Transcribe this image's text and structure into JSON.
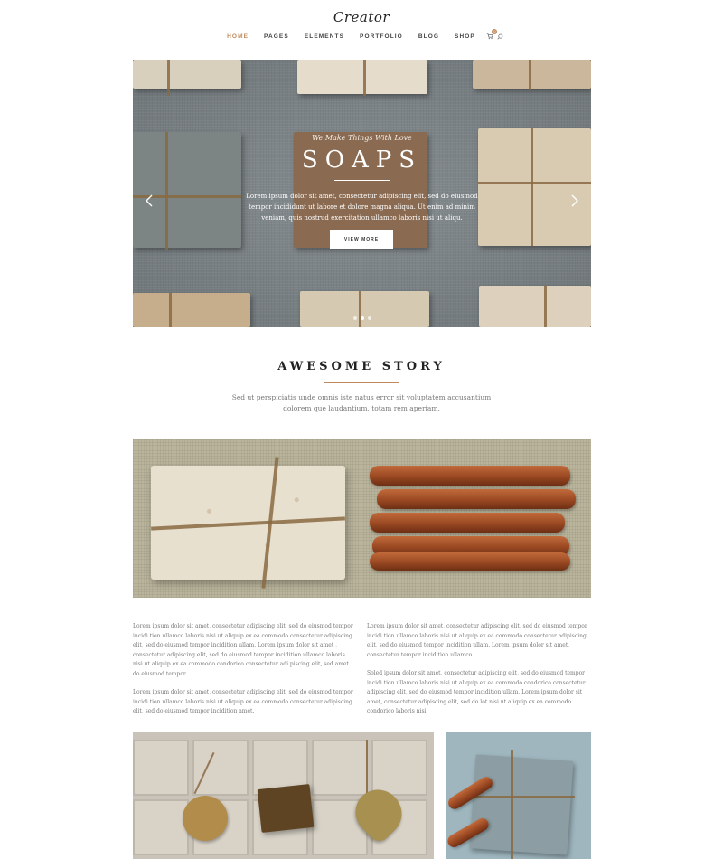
{
  "logo": "Creator",
  "nav": {
    "items": [
      "HOME",
      "PAGES",
      "ELEMENTS",
      "PORTFOLIO",
      "BLOG",
      "SHOP"
    ],
    "active": "HOME",
    "cart_count": "0",
    "icons": [
      "cart-icon",
      "search-icon"
    ]
  },
  "hero": {
    "tagline": "We Make Things With Love",
    "title": "SOAPS",
    "description": "Lorem ipsum dolor sit amet, consectetur adipiscing elit, sed do eiusmod tempor incididunt ut labore et dolore magna aliqua. Ut enim ad minim veniam, quis nostrud exercitation ullamco laboris nisi ut aliqu.",
    "button": "VIEW MORE",
    "slide_count": 3,
    "active_slide": 2
  },
  "story": {
    "title": "AWESOME STORY",
    "text": "Sed ut perspiciatis unde omnis iste natus error sit voluptatem accusantium dolorem que laudantium, totam rem aperiam."
  },
  "columns": {
    "left": [
      "Lorem ipsum dolor sit amet, consectetur adipiscing elit, sed do eiusmod tempor incidi tion ullamco laboris nisi ut aliquip ex ea commodo consectetur adipiscing elit, sed do eiusmod tempor incidition ullam. Lorem ipsum dolor sit amet , consectetur adipiscing elit, sed do eiusmod tempor incidition ullamco laboris nisi ut aliquip ex ea commodo condorico consectetur adi piscing elit, sed amet do eiusmod tempor.",
      "Lorem ipsum dolor sit amet, consectetur adipiscing elit, sed do eiusmod tempor incidi tion ullamco laboris nisi ut aliquip ex ea commodo consectetur adipiscing elit, sed do eiusmod tempor incidition amet."
    ],
    "right": [
      "Lorem ipsum dolor sit amet, consectetur adipiscing elit, sed do eiusmod tempor incidi tion ullamco laboris nisi ut aliquip ex ea commodo consectetur adipiscing elit, sed do eiusmod tempor incidition ullam. Lorem ipsum dolor sit amet, consectetur tempor incidition ullamco.",
      "Soled ipsum dolor sit amet, consectetur adipiscing elit, sed do eiusmod tempor incidi tion ullamco laboris nisi ut aliquip ex ea commodo condorico consectetur adipiscing elit, sed do eiusmod tempor incidition ullam. Lorem ipsum dolor sit amet, consectetur adipiscing elit, sed do lot nisi ut aliquip ex ea commodo condorico laboris nisi."
    ]
  },
  "colors": {
    "accent": "#c08a5e",
    "text": "#333333",
    "muted": "#777777"
  }
}
